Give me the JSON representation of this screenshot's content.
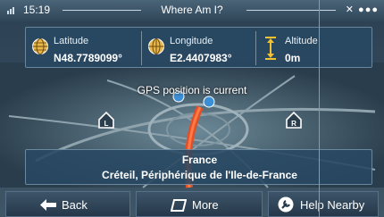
{
  "status_bar": {
    "time": "15:19",
    "title": "Where Am I?"
  },
  "location": {
    "latitude_label": "Latitude",
    "latitude_value": "N48.7789099°",
    "longitude_label": "Longitude",
    "longitude_value": "E2.4407983°",
    "altitude_label": "Altitude",
    "altitude_value": "0m"
  },
  "map": {
    "gps_status": "GPS position is current"
  },
  "address": {
    "country": "France",
    "street": "Créteil, Périphérique de l'Ile-de-France"
  },
  "buttons": {
    "back": "Back",
    "more": "More",
    "help_nearby": "Help Nearby"
  },
  "colors": {
    "panel": "#284862",
    "route": "#e0502a",
    "accent_line": "#21c6d6"
  }
}
